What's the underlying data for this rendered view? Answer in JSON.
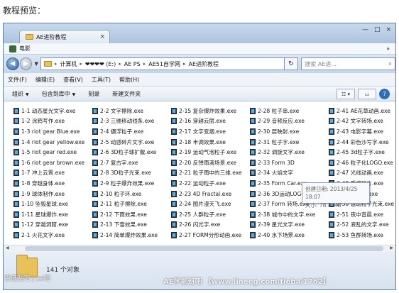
{
  "caption": "教程预览：",
  "window": {
    "tab_label": "AE进阶教程",
    "tab_close": "×",
    "controls": [
      "—",
      "□",
      "×"
    ],
    "bookmark": "电影",
    "bookmark_arrow": "»",
    "address": {
      "crumbs": [
        "计算机",
        "❤❤❤❤ (E:)",
        "AE PS",
        "AE51自学网",
        "AE进阶教程"
      ],
      "search_placeholder": "搜索 AE进..."
    },
    "menu": [
      "文件(F)",
      "编辑(E)",
      "查看(V)",
      "工具(T)",
      "帮助(H)"
    ],
    "toolbar": {
      "organize": "组织",
      "include": "包含到库中",
      "burn": "刻录",
      "new_folder": "新建文件夹"
    },
    "files": [
      "1-1 动态星光文字.exe",
      "1-2 涂鸦写作.exe",
      "1-3 riot gear Blue.exe",
      "1-4 riot gear yellow.exe",
      "1-5 riot gear red.exe",
      "1-6 riot gear brown.exe",
      "1-7 冲上云霄.exe",
      "1-8 穿越身体.exe",
      "1-9 球体制作.exe",
      "1-10 坠毁星球.exe",
      "1-11 星球爆炸.exe",
      "1-12 穿越洞窟.exe",
      "2-1 火花文字.exe",
      "2-2 文字擦除.exe",
      "2-3 三维移动线条.exe",
      "2-4 摄浮粒子.exe",
      "2-5 动感碎片文字.exe",
      "2-6 3D粒子球扩散.exe",
      "2-7 复古字.exe",
      "2-8 3D粒子光束.exe",
      "2-9 粒子爆炸效果.exe",
      "2-10 粒子环.exe",
      "2-11 粒子擦除.exe",
      "2-12 下雨效果.exe",
      "2-13 下雪效果.exe",
      "2-14 简单爆炸效果.exe",
      "2-15 复杂爆炸效果.exe",
      "2-16 穿越云层.exe",
      "2-17 文字变烟.exe",
      "2-18 半调效果.exe",
      "2-19 运动气泡粒子.exe",
      "2-20 反弹雨滴场景.exe",
      "2-21 粒子雨中的三维.exe",
      "2-22 运动粒子.exe",
      "2-23 4D Fractal.exe",
      "2-24 图片漫天飞.exe",
      "2-25 人群粒子.exe",
      "2-26 闪光字.exe",
      "2-27 FORM分形动画.exe",
      "2-28 粒子串.exe",
      "2-29 音频反应.exe",
      "2-30 层映射.exe",
      "2-31 粒子字.exe",
      "2-32 调旋文字.exe",
      "2-33 Form 3D",
      "2-34 火焰文字",
      "2-35 Form Car.exe",
      "2-36 3D运动LOGO.exe",
      "2-37 Form 转场.exe",
      "2-38 城市中的文字.exe",
      "2-39 星光文字.exe",
      "2-40 水下场景.exe",
      "2-41 AE花草动画.exe",
      "2-42 文字转场.exe",
      "2-43 电影字幕.exe",
      "2-44 彩色沙写字.exe",
      "2-45 3d粒子字.exe",
      "2-46 粒子化LOGO.exe",
      "2-47 光线动画.exe",
      "2-48 质感碎片.exe",
      "2-49 粒子树.exe",
      "2-50 运动粒子光束.exe",
      "2-51 夜中音晨.exe",
      "2-52 液乱的文字.exe",
      "2-53 鱼群转场.exe"
    ],
    "tooltip": {
      "date": "创建日期: 2013/4/25 18:07",
      "size": "大小: 78.3 MB"
    },
    "status": "141 个对象"
  },
  "watermark": {
    "left": "百度贴吧 | ae吧",
    "right": "AE学前班吧   【www.lineeg.com/tieba/1762】"
  }
}
